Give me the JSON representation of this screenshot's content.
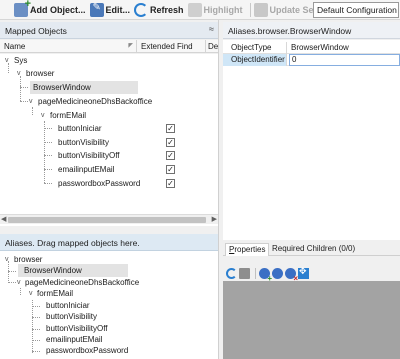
{
  "toolbar": {
    "add_object": "Add Object...",
    "edit": "Edit...",
    "refresh": "Refresh",
    "highlight": "Highlight",
    "update_selectors": "Update Selectors",
    "configuration": "Default Configuration"
  },
  "mapped_panel": {
    "title": "Mapped Objects",
    "collapse_glyph": "≈",
    "columns": {
      "name": "Name",
      "extended_find": "Extended Find",
      "de": "De"
    },
    "tree": [
      {
        "label": "Sys",
        "expander": "v"
      },
      {
        "label": "browser",
        "expander": "v"
      },
      {
        "label": "BrowserWindow",
        "selected": true
      },
      {
        "label": "pageMedicineoneDhsBackoffice",
        "expander": "v"
      },
      {
        "label": "formEMail",
        "expander": "v"
      },
      {
        "label": "buttonIniciar",
        "extended_find": true
      },
      {
        "label": "buttonVisibility",
        "extended_find": true
      },
      {
        "label": "buttonVisibilityOff",
        "extended_find": true
      },
      {
        "label": "emailinputEMail",
        "extended_find": true
      },
      {
        "label": "passwordboxPassword",
        "extended_find": true
      }
    ]
  },
  "aliases_panel": {
    "title": "Aliases. Drag mapped objects here.",
    "tree": [
      {
        "label": "browser",
        "expander": "v"
      },
      {
        "label": "BrowserWindow",
        "selected": true
      },
      {
        "label": "pageMedicineoneDhsBackoffice",
        "expander": "v"
      },
      {
        "label": "formEMail",
        "expander": "v"
      },
      {
        "label": "buttonIniciar"
      },
      {
        "label": "buttonVisibility"
      },
      {
        "label": "buttonVisibilityOff"
      },
      {
        "label": "emailinputEMail"
      },
      {
        "label": "passwordboxPassword"
      }
    ]
  },
  "properties_panel": {
    "title": "Aliases.browser.BrowserWindow",
    "rows": [
      {
        "key": "ObjectType",
        "value": "BrowserWindow"
      },
      {
        "key": "ObjectIdentifier",
        "value": "0"
      }
    ],
    "tabs": {
      "properties_first": "P",
      "properties_rest": "roperties",
      "required_children": "Required Children (0/0)"
    }
  },
  "colors": {
    "selection": "#e3e3e3",
    "panel_header": "#e4eaf1",
    "empty_area": "#a3a3a3"
  }
}
